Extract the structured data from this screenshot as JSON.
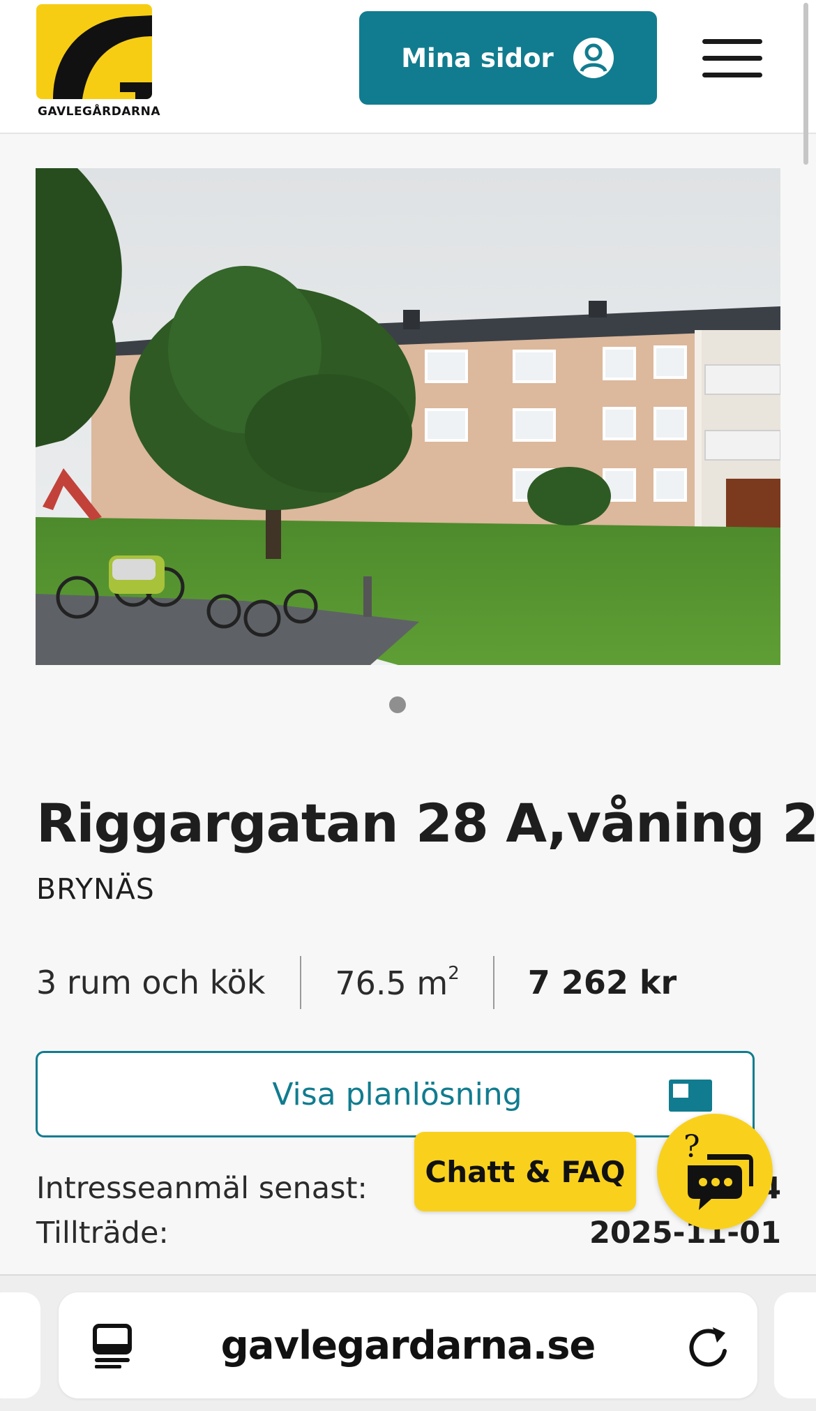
{
  "header": {
    "logo_text": "GAVLEGÅRDARNA",
    "mina_sidor_label": "Mina sidor",
    "brand_color": "#117c8f",
    "logo_color": "#f7cd14"
  },
  "carousel": {
    "image_alt": "Bostadshus på Riggargatan",
    "slide_count": 1,
    "active_slide": 1
  },
  "listing": {
    "title": "Riggargatan 28 A,våning 2",
    "area": "BRYNÄS",
    "rooms": "3 rum och kök",
    "size_value": "76.5 m",
    "size_unit_sup": "2",
    "rent": "7 262 kr",
    "floorplan_label": "Visa planlösning",
    "interest_label": "Intresseanmäl senast:",
    "interest_value": "2…4",
    "access_label": "Tillträde:",
    "access_value": "2025-11-01"
  },
  "chat": {
    "label": "Chatt & FAQ",
    "color": "#f9d11d"
  },
  "browser": {
    "url": "gavlegardarna.se"
  },
  "icons": [
    "user-circle-icon",
    "hamburger-menu-icon",
    "floorplan-icon",
    "chat-faq-icon",
    "tabs-icon",
    "reload-icon"
  ]
}
